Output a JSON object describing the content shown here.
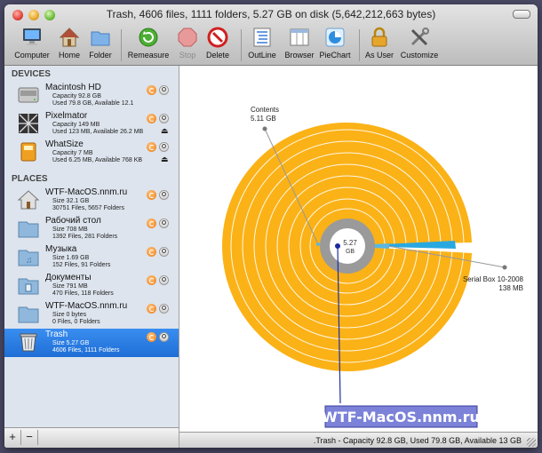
{
  "window": {
    "title": "Trash, 4606 files, 1111 folders, 5.27 GB on disk (5,642,212,663 bytes)"
  },
  "toolbar": {
    "computer": "Computer",
    "home": "Home",
    "folder": "Folder",
    "remeasure": "Remeasure",
    "stop": "Stop",
    "delete": "Delete",
    "outline": "OutLine",
    "browser": "Browser",
    "piechart": "PieChart",
    "as_user": "As User",
    "customize": "Customize"
  },
  "sidebar": {
    "devices_header": "DEVICES",
    "places_header": "PLACES",
    "devices": [
      {
        "name": "Macintosh HD",
        "line1": "Capacity 92.8 GB",
        "line2": "Used 79.8 GB, Available 12.1"
      },
      {
        "name": "Pixelmator",
        "line1": "Capacity 149 MB",
        "line2": "Used 123 MB, Available 26.2 MB"
      },
      {
        "name": "WhatSize",
        "line1": "Capacity 7 MB",
        "line2": "Used 6.25 MB, Available 768 KB"
      }
    ],
    "places": [
      {
        "name": "WTF-MacOS.nnm.ru",
        "line1": "Size 32.1 GB",
        "line2": "30751 Files, 5657 Folders"
      },
      {
        "name": "Рабочий стол",
        "line1": "Size 708 MB",
        "line2": "1392 Files, 281 Folders"
      },
      {
        "name": "Музыка",
        "line1": "Size 1.69 GB",
        "line2": "152 Files, 91 Folders"
      },
      {
        "name": "Документы",
        "line1": "Size 791 MB",
        "line2": "470 Files, 118 Folders"
      },
      {
        "name": "WTF-MacOS.nnm.ru",
        "line1": "Size 0 bytes",
        "line2": "0 Files, 0 Folders"
      },
      {
        "name": "Trash",
        "line1": "Size 5.27 GB",
        "line2": "4606 Files, 1111 Folders"
      }
    ],
    "add": "+",
    "remove": "−"
  },
  "chart": {
    "center_value": "5.27",
    "center_unit": "GB",
    "label_contents_name": "Contents",
    "label_contents_size": "5.11 GB",
    "label_serial_name": "Serial Box 10-2008",
    "label_serial_size": "138 MB",
    "watermark": "WTF-MacOS.nnm.ru",
    "accent_color": "#fbb217",
    "wedge_color": "#29a8e0"
  },
  "status": {
    "text": ".Trash - Capacity 92.8 GB, Used 79.8 GB, Available 13 GB"
  }
}
